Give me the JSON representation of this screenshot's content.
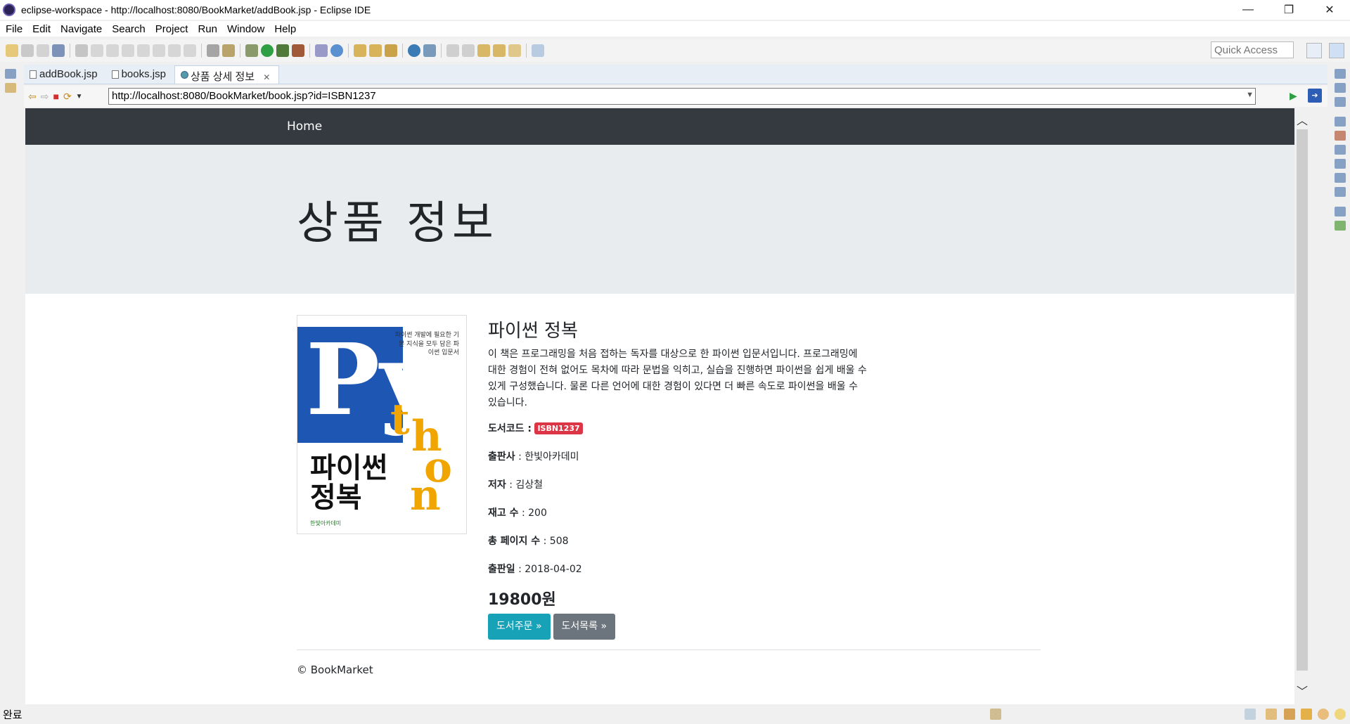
{
  "window": {
    "title": "eclipse-workspace - http://localhost:8080/BookMarket/addBook.jsp - Eclipse IDE",
    "controls": {
      "minimize": "—",
      "restore": "❐",
      "close": "✕"
    }
  },
  "menu": [
    "File",
    "Edit",
    "Navigate",
    "Search",
    "Project",
    "Run",
    "Window",
    "Help"
  ],
  "toolbar": {
    "quick_access_placeholder": "Quick Access"
  },
  "tabs": [
    {
      "label": "addBook.jsp",
      "active": false
    },
    {
      "label": "books.jsp",
      "active": false
    },
    {
      "label": "상품 상세 정보",
      "active": true,
      "close": "✕"
    }
  ],
  "browser": {
    "url": "http://localhost:8080/BookMarket/book.jsp?id=ISBN1237",
    "dropdown_icon": "chevron-down-icon"
  },
  "page": {
    "nav": {
      "home": "Home"
    },
    "jumbotron_title": "상품 정보",
    "cover": {
      "big_letter": "Py",
      "gold_letters": [
        "t",
        "h",
        "o",
        "n"
      ],
      "title_line1": "파이썬",
      "title_line2": "정복",
      "tagline": "파이썬 개발에 필요한 기본 지식을 모두 담은 파이썬 입문서",
      "publisher": "한빛아카데미"
    },
    "book": {
      "name": "파이썬 정복",
      "description": "이 책은 프로그래밍을 처음 접하는 독자를 대상으로 한 파이썬 입문서입니다. 프로그래밍에 대한 경험이 전혀 없어도 목차에 따라 문법을 익히고, 실습을 진행하면 파이썬을 쉽게 배울 수 있게 구성했습니다. 물론 다른 언어에 대한 경험이 있다면 더 빠른 속도로 파이썬을 배울 수 있습니다.",
      "code_label": "도서코드 :",
      "code": "ISBN1237",
      "publisher_label": "출판사",
      "publisher": "한빛아카데미",
      "author_label": "저자",
      "author": "김상철",
      "stock_label": "재고 수",
      "stock": "200",
      "pages_label": "총 페이지 수",
      "pages": "508",
      "date_label": "출판일",
      "date": "2018-04-02",
      "price": "19800원"
    },
    "buttons": {
      "order": "도서주문 »",
      "list": "도서목록 »"
    },
    "footer": "© BookMarket"
  },
  "status": {
    "text": "완료"
  }
}
